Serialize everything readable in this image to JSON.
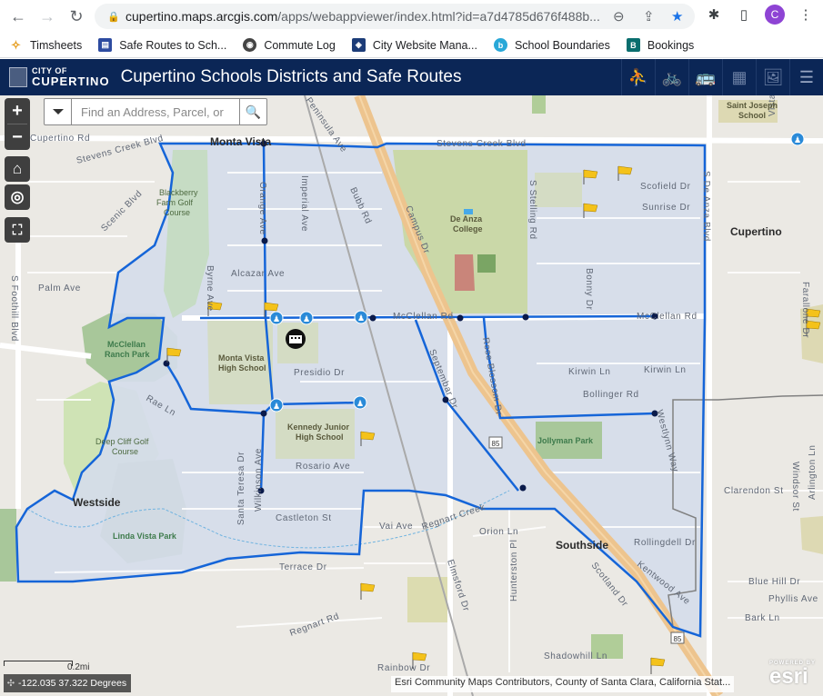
{
  "browser": {
    "url_host": "cupertino.maps.arcgis.com",
    "url_path": "/apps/webappviewer/index.html?id=a7d4785d676f488b...",
    "profile_initial": "C",
    "bookmarks": [
      {
        "label": "Timsheets",
        "icon": "timesheets-icon",
        "color": "#e59b1a"
      },
      {
        "label": "Safe Routes to Sch...",
        "icon": "safe-routes-icon",
        "color": "#2d4ba0"
      },
      {
        "label": "Commute Log",
        "icon": "globe-icon",
        "color": "#444444"
      },
      {
        "label": "City Website Mana...",
        "icon": "city-website-icon",
        "color": "#1c3c78"
      },
      {
        "label": "School Boundaries",
        "icon": "school-boundaries-icon",
        "color": "#29a8d8"
      },
      {
        "label": "Bookings",
        "icon": "bookings-icon",
        "color": "#0a6e6e"
      }
    ]
  },
  "header": {
    "logo_line1": "CITY OF",
    "logo_line2": "CUPERTINO",
    "title": "Cupertino Schools Districts and Safe Routes",
    "tools": [
      {
        "name": "crossing-guard-widget",
        "glyph": "⛹"
      },
      {
        "name": "bike-widget",
        "glyph": "🚲"
      },
      {
        "name": "bus-widget",
        "glyph": "🚌"
      },
      {
        "name": "boundaries-widget",
        "glyph": "▦"
      },
      {
        "name": "basemap-gallery-widget",
        "glyph": "🖼"
      },
      {
        "name": "layer-list-widget",
        "glyph": "☰"
      }
    ]
  },
  "search": {
    "placeholder": "Find an Address, Parcel, or"
  },
  "map": {
    "scale_label": "0.2mi",
    "coordinates": "-122.035 37.322 Degrees",
    "attribution": "Esri Community Maps Contributors, County of Santa Clara, California Stat...",
    "esri_powered": "POWERED BY",
    "esri": "esri",
    "route_color": "#1565d8",
    "district_fill": "#d5dcea",
    "labels": {
      "places": [
        "Monta Vista",
        "Cupertino",
        "Westside",
        "Southside"
      ],
      "roads": [
        "Cupertino Rd",
        "Stevens Creek Blvd",
        "Scenic Blvd",
        "Orange Ave",
        "Imperial Ave",
        "Bubb Rd",
        "Campus Dr",
        "S Stelling Rd",
        "Scofield Dr",
        "Sunrise Dr",
        "S De Anza Blvd",
        "Alcazar Ave",
        "Byrne Ave",
        "McClellan Rd",
        "Bonny Dr",
        "Presidio Dr",
        "Kirwin Ln",
        "Bollinger Rd",
        "Rae Ln",
        "Palm Ave",
        "S Foothill Blvd",
        "Rosario Ave",
        "Santa Teresa Dr",
        "Wilkinson Ave",
        "Castleton St",
        "Vai Ave",
        "Orion Ln",
        "Terrace Dr",
        "Elmsford Dr",
        "Hunterston Pl",
        "Scotland Dr",
        "Kentwood Ave",
        "Rollingdell Dr",
        "Westlynn Way",
        "Clarendon St",
        "Windsor St",
        "Arlington Ln",
        "Blue Hill Dr",
        "Phyllis Ave",
        "Bark Ln",
        "Regnart Rd",
        "Rainbow Dr",
        "Shadowhill Ln",
        "Septembar Dr",
        "Rose Blossom Dr",
        "Farallone Dr",
        "Vista",
        "Regnart Creek",
        "Peninsula Ave"
      ],
      "pois": [
        "Blackberry Farm Golf Course",
        "McClellan Ranch Park",
        "Deep Cliff Golf Course",
        "Linda Vista Park",
        "Monta Vista High School",
        "Kennedy Junior High School",
        "De Anza College",
        "Jollyman Park",
        "Saint Joseph School"
      ],
      "highway_shield": "85"
    }
  }
}
